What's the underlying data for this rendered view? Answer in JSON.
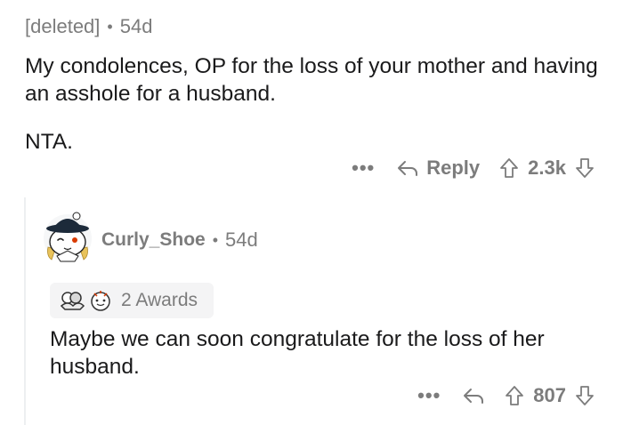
{
  "parent_comment": {
    "author": "[deleted]",
    "separator": "•",
    "age": "54d",
    "paragraphs": [
      "My condolences, OP for the loss of your mother and having an asshole for a husband.",
      "NTA."
    ],
    "actions": {
      "more_label": "•••",
      "reply_label": "Reply",
      "score": "2.3k"
    }
  },
  "reply_comment": {
    "author": "Curly_Shoe",
    "separator": "•",
    "age": "54d",
    "awards_label": "2 Awards",
    "body": "Maybe we can soon congratulate for the loss of her husband.",
    "actions": {
      "more_label": "•••",
      "score": "807"
    }
  },
  "icons": {
    "reply": "reply-arrow-icon",
    "upvote": "upvote-arrow-icon",
    "downvote": "downvote-arrow-icon",
    "avatar": "snoo-avatar-icon",
    "award_1": "hug-award-icon",
    "award_2": "wholesome-award-icon"
  },
  "colors": {
    "meta_text": "#7c7c7c",
    "body_text": "#1a1a1b",
    "award_bg": "#f4f4f5"
  }
}
